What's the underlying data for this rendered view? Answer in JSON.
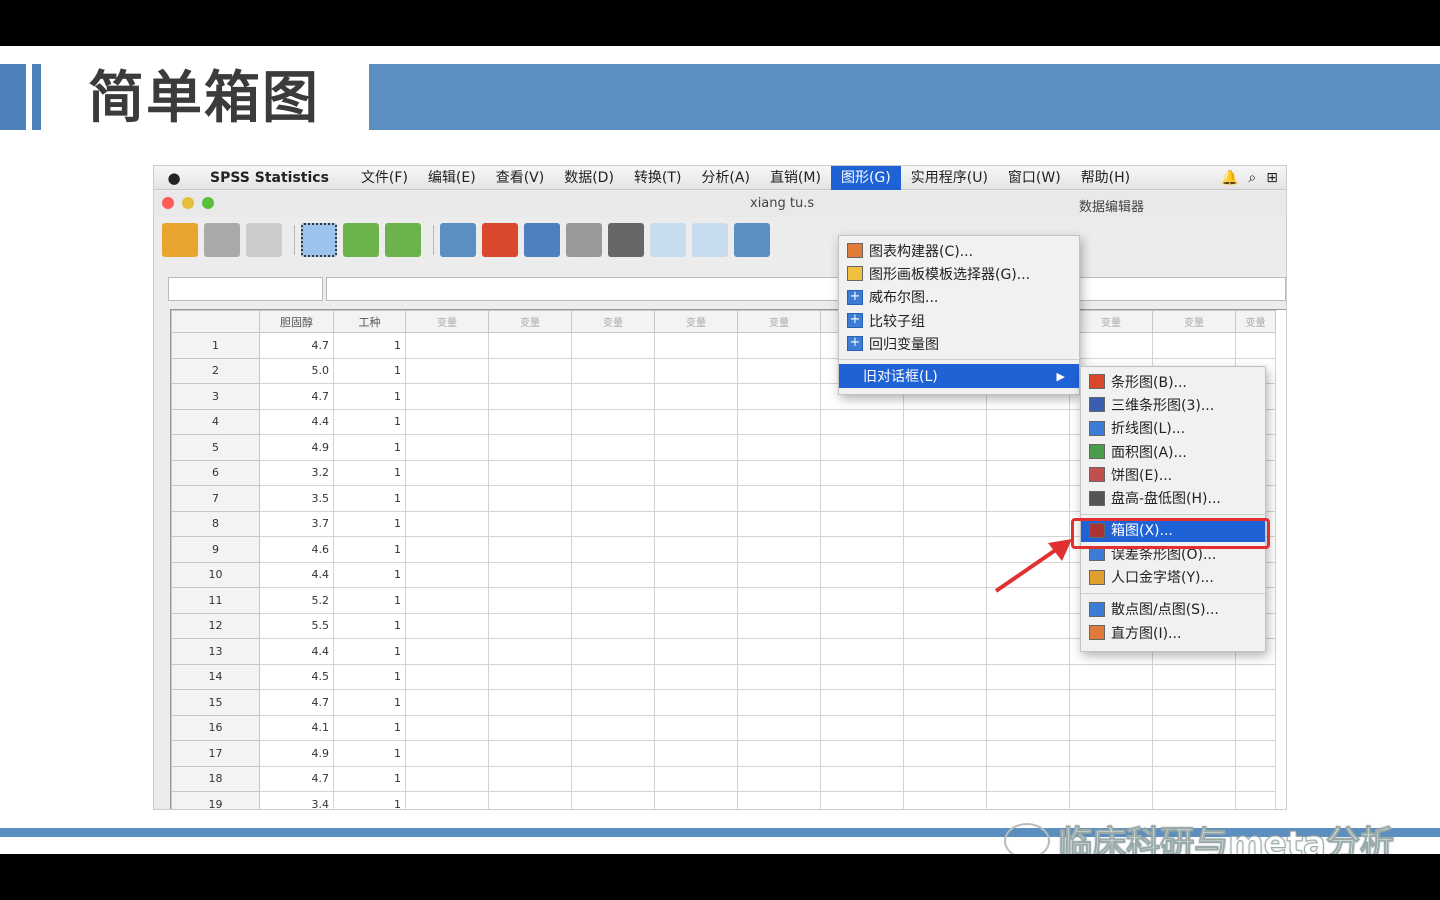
{
  "slide": {
    "title": "简单箱图",
    "watermark": "临床科研与meta分析"
  },
  "menubar": {
    "app_name": "SPSS Statistics",
    "items": [
      "文件(F)",
      "编辑(E)",
      "查看(V)",
      "数据(D)",
      "转换(T)",
      "分析(A)",
      "直销(M)",
      "图形(G)",
      "实用程序(U)",
      "窗口(W)",
      "帮助(H)"
    ],
    "active": "图形(G)"
  },
  "window": {
    "title_fragment": "xiang tu.s",
    "title_right": "数据编辑器"
  },
  "graphs_menu": {
    "items": [
      {
        "label": "图表构建器(C)...",
        "icon": "chart-builder-icon"
      },
      {
        "label": "图形画板模板选择器(G)...",
        "icon": "template-chooser-icon"
      },
      {
        "label": "威布尔图...",
        "icon": "plus-icon"
      },
      {
        "label": "比较子组",
        "icon": "plus-icon"
      },
      {
        "label": "回归变量图",
        "icon": "plus-icon"
      }
    ],
    "legacy_label": "旧对话框(L)"
  },
  "legacy_submenu": {
    "group1": [
      "条形图(B)...",
      "三维条形图(3)...",
      "折线图(L)...",
      "面积图(A)...",
      "饼图(E)...",
      "盘高-盘低图(H)..."
    ],
    "group2": [
      "箱图(X)...",
      "误差条形图(O)...",
      "人口金字塔(Y)..."
    ],
    "group3": [
      "散点图/点图(S)...",
      "直方图(I)..."
    ],
    "highlighted": "箱图(X)..."
  },
  "grid": {
    "columns": [
      "胆固醇",
      "工种",
      "变量",
      "变量",
      "变量",
      "变量",
      "变量",
      "变量",
      "变量",
      "变量",
      "变量",
      "变量",
      "变量"
    ],
    "rows": [
      [
        "1",
        "4.7",
        "1"
      ],
      [
        "2",
        "5.0",
        "1"
      ],
      [
        "3",
        "4.7",
        "1"
      ],
      [
        "4",
        "4.4",
        "1"
      ],
      [
        "5",
        "4.9",
        "1"
      ],
      [
        "6",
        "3.2",
        "1"
      ],
      [
        "7",
        "3.5",
        "1"
      ],
      [
        "8",
        "3.7",
        "1"
      ],
      [
        "9",
        "4.6",
        "1"
      ],
      [
        "10",
        "4.4",
        "1"
      ],
      [
        "11",
        "5.2",
        "1"
      ],
      [
        "12",
        "5.5",
        "1"
      ],
      [
        "13",
        "4.4",
        "1"
      ],
      [
        "14",
        "4.5",
        "1"
      ],
      [
        "15",
        "4.7",
        "1"
      ],
      [
        "16",
        "4.1",
        "1"
      ],
      [
        "17",
        "4.9",
        "1"
      ],
      [
        "18",
        "4.7",
        "1"
      ],
      [
        "19",
        "3.4",
        "1"
      ]
    ]
  },
  "colors": {
    "accent_blue": "#5b8fc0",
    "menu_highlight": "#1f62d6",
    "annotation_red": "#e03030"
  }
}
